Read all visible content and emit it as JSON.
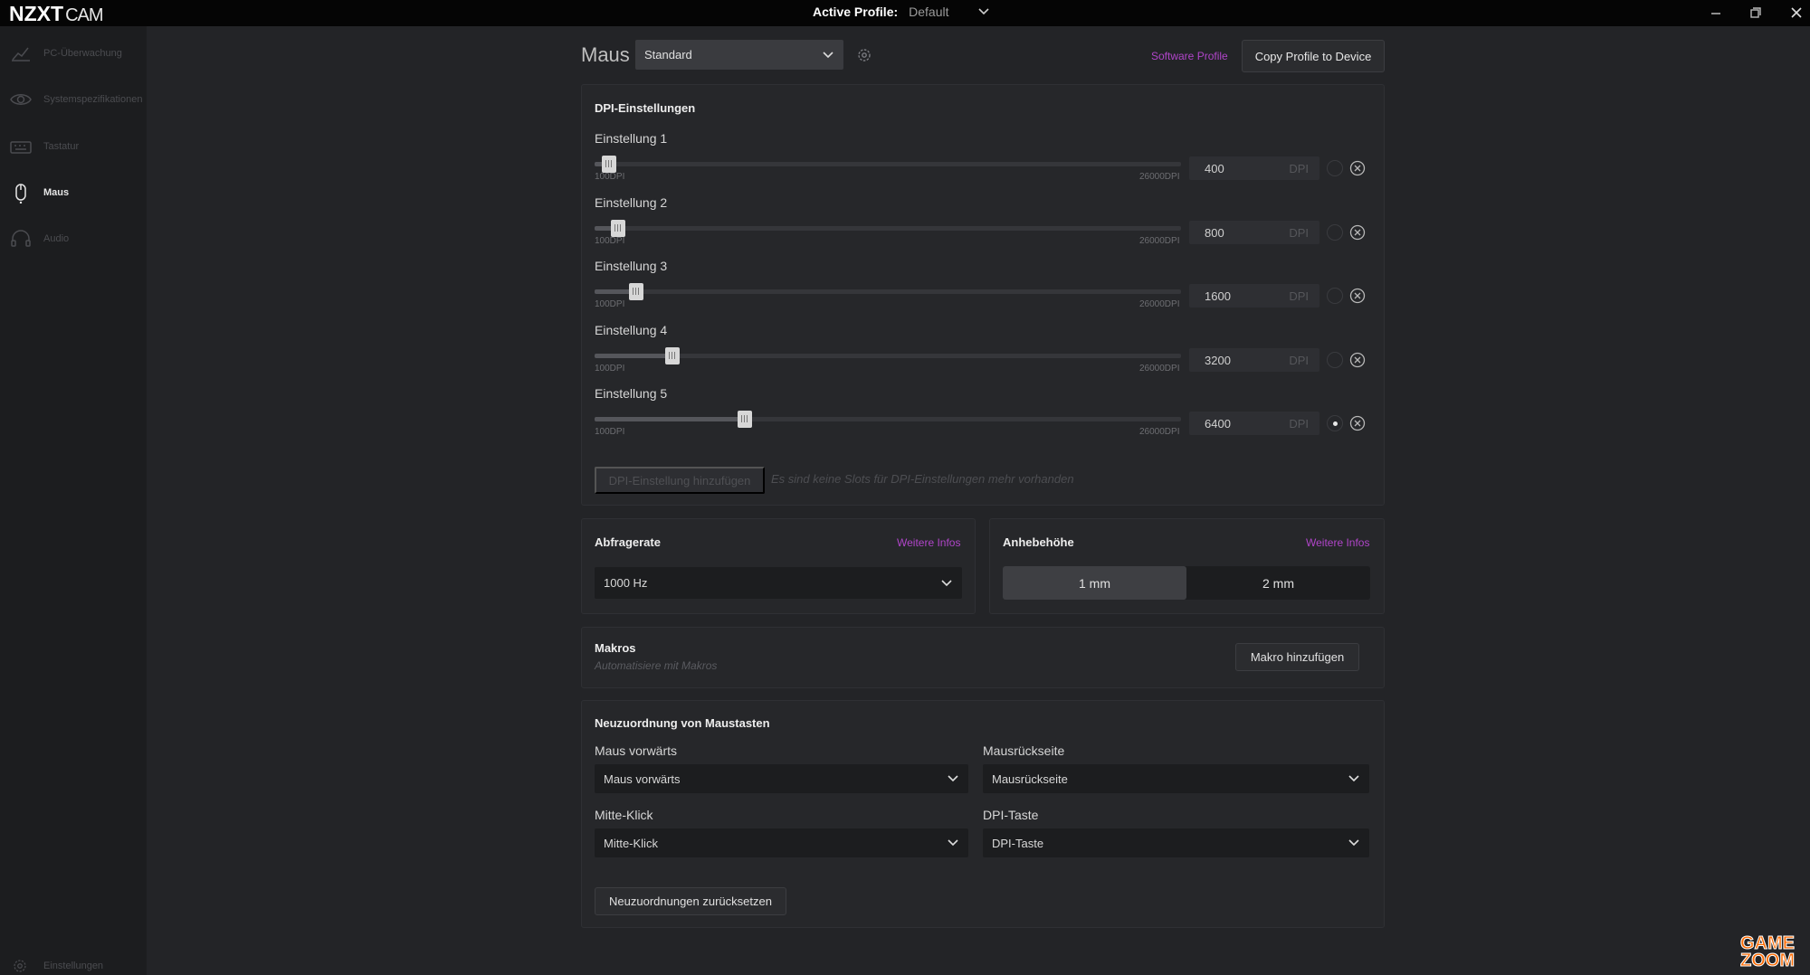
{
  "app": {
    "brand": "NZXT",
    "product": "CAM"
  },
  "titlebar": {
    "active_profile_label": "Active Profile:",
    "active_profile_value": "Default"
  },
  "sidebar": {
    "items": [
      {
        "label": "PC-Überwachung",
        "icon": "chart-line-icon",
        "active": false
      },
      {
        "label": "Systemspezifikationen",
        "icon": "eye-icon",
        "active": false
      },
      {
        "label": "Tastatur",
        "icon": "keyboard-icon",
        "active": false
      },
      {
        "label": "Maus",
        "icon": "mouse-icon",
        "active": true
      },
      {
        "label": "Audio",
        "icon": "headset-icon",
        "active": false
      }
    ],
    "settings_label": "Einstellungen"
  },
  "header": {
    "device_title": "Maus",
    "profile_select": "Standard",
    "software_profile": "Software Profile",
    "copy_button": "Copy Profile to Device"
  },
  "dpi": {
    "title": "DPI-Einstellungen",
    "min_label": "100DPI",
    "max_label": "26000DPI",
    "min": 100,
    "max": 26000,
    "unit": "DPI",
    "settings": [
      {
        "label": "Einstellung 1",
        "value": "400",
        "active": false
      },
      {
        "label": "Einstellung 2",
        "value": "800",
        "active": false
      },
      {
        "label": "Einstellung 3",
        "value": "1600",
        "active": false
      },
      {
        "label": "Einstellung 4",
        "value": "3200",
        "active": false
      },
      {
        "label": "Einstellung 5",
        "value": "6400",
        "active": true
      }
    ],
    "add_button": "DPI-Einstellung hinzufügen",
    "no_slots_text": "Es sind keine Slots für DPI-Einstellungen mehr vorhanden"
  },
  "polling": {
    "title": "Abfragerate",
    "more": "Weitere Infos",
    "value": "1000 Hz"
  },
  "lift": {
    "title": "Anhebehöhe",
    "more": "Weitere Infos",
    "options": [
      "1 mm",
      "2 mm"
    ],
    "selected": "1 mm"
  },
  "macros": {
    "title": "Makros",
    "subtitle": "Automatisiere mit Makros",
    "add_button": "Makro hinzufügen"
  },
  "remap": {
    "title": "Neuzuordnung von Maustasten",
    "fields": [
      {
        "label": "Maus vorwärts",
        "value": "Maus vorwärts"
      },
      {
        "label": "Mausrückseite",
        "value": "Mausrückseite"
      },
      {
        "label": "Mitte-Klick",
        "value": "Mitte-Klick"
      },
      {
        "label": "DPI-Taste",
        "value": "DPI-Taste"
      }
    ],
    "reset_button": "Neuzuordnungen zurücksetzen"
  },
  "watermark": {
    "line1": "GAME",
    "line2": "ZOOM"
  },
  "colors": {
    "accent": "#b045c9",
    "background": "#232427",
    "sidebar": "#1c1d1f",
    "watermark": "#ff6a00"
  }
}
